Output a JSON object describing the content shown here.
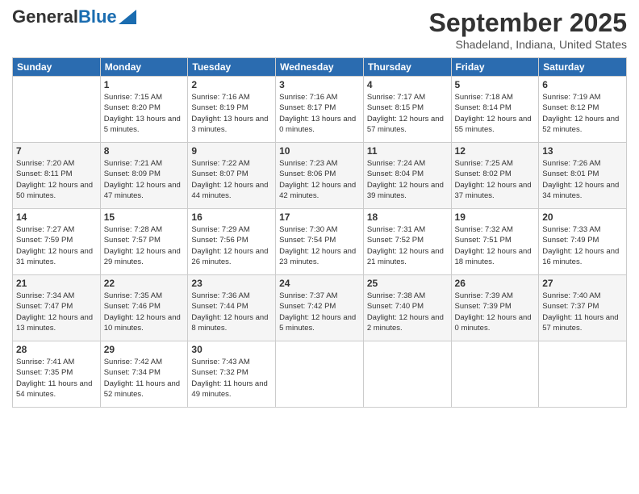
{
  "header": {
    "logo_general": "General",
    "logo_blue": "Blue",
    "title": "September 2025",
    "subtitle": "Shadeland, Indiana, United States"
  },
  "days_of_week": [
    "Sunday",
    "Monday",
    "Tuesday",
    "Wednesday",
    "Thursday",
    "Friday",
    "Saturday"
  ],
  "weeks": [
    [
      {
        "day": "",
        "sunrise": "",
        "sunset": "",
        "daylight": ""
      },
      {
        "day": "1",
        "sunrise": "Sunrise: 7:15 AM",
        "sunset": "Sunset: 8:20 PM",
        "daylight": "Daylight: 13 hours and 5 minutes."
      },
      {
        "day": "2",
        "sunrise": "Sunrise: 7:16 AM",
        "sunset": "Sunset: 8:19 PM",
        "daylight": "Daylight: 13 hours and 3 minutes."
      },
      {
        "day": "3",
        "sunrise": "Sunrise: 7:16 AM",
        "sunset": "Sunset: 8:17 PM",
        "daylight": "Daylight: 13 hours and 0 minutes."
      },
      {
        "day": "4",
        "sunrise": "Sunrise: 7:17 AM",
        "sunset": "Sunset: 8:15 PM",
        "daylight": "Daylight: 12 hours and 57 minutes."
      },
      {
        "day": "5",
        "sunrise": "Sunrise: 7:18 AM",
        "sunset": "Sunset: 8:14 PM",
        "daylight": "Daylight: 12 hours and 55 minutes."
      },
      {
        "day": "6",
        "sunrise": "Sunrise: 7:19 AM",
        "sunset": "Sunset: 8:12 PM",
        "daylight": "Daylight: 12 hours and 52 minutes."
      }
    ],
    [
      {
        "day": "7",
        "sunrise": "Sunrise: 7:20 AM",
        "sunset": "Sunset: 8:11 PM",
        "daylight": "Daylight: 12 hours and 50 minutes."
      },
      {
        "day": "8",
        "sunrise": "Sunrise: 7:21 AM",
        "sunset": "Sunset: 8:09 PM",
        "daylight": "Daylight: 12 hours and 47 minutes."
      },
      {
        "day": "9",
        "sunrise": "Sunrise: 7:22 AM",
        "sunset": "Sunset: 8:07 PM",
        "daylight": "Daylight: 12 hours and 44 minutes."
      },
      {
        "day": "10",
        "sunrise": "Sunrise: 7:23 AM",
        "sunset": "Sunset: 8:06 PM",
        "daylight": "Daylight: 12 hours and 42 minutes."
      },
      {
        "day": "11",
        "sunrise": "Sunrise: 7:24 AM",
        "sunset": "Sunset: 8:04 PM",
        "daylight": "Daylight: 12 hours and 39 minutes."
      },
      {
        "day": "12",
        "sunrise": "Sunrise: 7:25 AM",
        "sunset": "Sunset: 8:02 PM",
        "daylight": "Daylight: 12 hours and 37 minutes."
      },
      {
        "day": "13",
        "sunrise": "Sunrise: 7:26 AM",
        "sunset": "Sunset: 8:01 PM",
        "daylight": "Daylight: 12 hours and 34 minutes."
      }
    ],
    [
      {
        "day": "14",
        "sunrise": "Sunrise: 7:27 AM",
        "sunset": "Sunset: 7:59 PM",
        "daylight": "Daylight: 12 hours and 31 minutes."
      },
      {
        "day": "15",
        "sunrise": "Sunrise: 7:28 AM",
        "sunset": "Sunset: 7:57 PM",
        "daylight": "Daylight: 12 hours and 29 minutes."
      },
      {
        "day": "16",
        "sunrise": "Sunrise: 7:29 AM",
        "sunset": "Sunset: 7:56 PM",
        "daylight": "Daylight: 12 hours and 26 minutes."
      },
      {
        "day": "17",
        "sunrise": "Sunrise: 7:30 AM",
        "sunset": "Sunset: 7:54 PM",
        "daylight": "Daylight: 12 hours and 23 minutes."
      },
      {
        "day": "18",
        "sunrise": "Sunrise: 7:31 AM",
        "sunset": "Sunset: 7:52 PM",
        "daylight": "Daylight: 12 hours and 21 minutes."
      },
      {
        "day": "19",
        "sunrise": "Sunrise: 7:32 AM",
        "sunset": "Sunset: 7:51 PM",
        "daylight": "Daylight: 12 hours and 18 minutes."
      },
      {
        "day": "20",
        "sunrise": "Sunrise: 7:33 AM",
        "sunset": "Sunset: 7:49 PM",
        "daylight": "Daylight: 12 hours and 16 minutes."
      }
    ],
    [
      {
        "day": "21",
        "sunrise": "Sunrise: 7:34 AM",
        "sunset": "Sunset: 7:47 PM",
        "daylight": "Daylight: 12 hours and 13 minutes."
      },
      {
        "day": "22",
        "sunrise": "Sunrise: 7:35 AM",
        "sunset": "Sunset: 7:46 PM",
        "daylight": "Daylight: 12 hours and 10 minutes."
      },
      {
        "day": "23",
        "sunrise": "Sunrise: 7:36 AM",
        "sunset": "Sunset: 7:44 PM",
        "daylight": "Daylight: 12 hours and 8 minutes."
      },
      {
        "day": "24",
        "sunrise": "Sunrise: 7:37 AM",
        "sunset": "Sunset: 7:42 PM",
        "daylight": "Daylight: 12 hours and 5 minutes."
      },
      {
        "day": "25",
        "sunrise": "Sunrise: 7:38 AM",
        "sunset": "Sunset: 7:40 PM",
        "daylight": "Daylight: 12 hours and 2 minutes."
      },
      {
        "day": "26",
        "sunrise": "Sunrise: 7:39 AM",
        "sunset": "Sunset: 7:39 PM",
        "daylight": "Daylight: 12 hours and 0 minutes."
      },
      {
        "day": "27",
        "sunrise": "Sunrise: 7:40 AM",
        "sunset": "Sunset: 7:37 PM",
        "daylight": "Daylight: 11 hours and 57 minutes."
      }
    ],
    [
      {
        "day": "28",
        "sunrise": "Sunrise: 7:41 AM",
        "sunset": "Sunset: 7:35 PM",
        "daylight": "Daylight: 11 hours and 54 minutes."
      },
      {
        "day": "29",
        "sunrise": "Sunrise: 7:42 AM",
        "sunset": "Sunset: 7:34 PM",
        "daylight": "Daylight: 11 hours and 52 minutes."
      },
      {
        "day": "30",
        "sunrise": "Sunrise: 7:43 AM",
        "sunset": "Sunset: 7:32 PM",
        "daylight": "Daylight: 11 hours and 49 minutes."
      },
      {
        "day": "",
        "sunrise": "",
        "sunset": "",
        "daylight": ""
      },
      {
        "day": "",
        "sunrise": "",
        "sunset": "",
        "daylight": ""
      },
      {
        "day": "",
        "sunrise": "",
        "sunset": "",
        "daylight": ""
      },
      {
        "day": "",
        "sunrise": "",
        "sunset": "",
        "daylight": ""
      }
    ]
  ]
}
